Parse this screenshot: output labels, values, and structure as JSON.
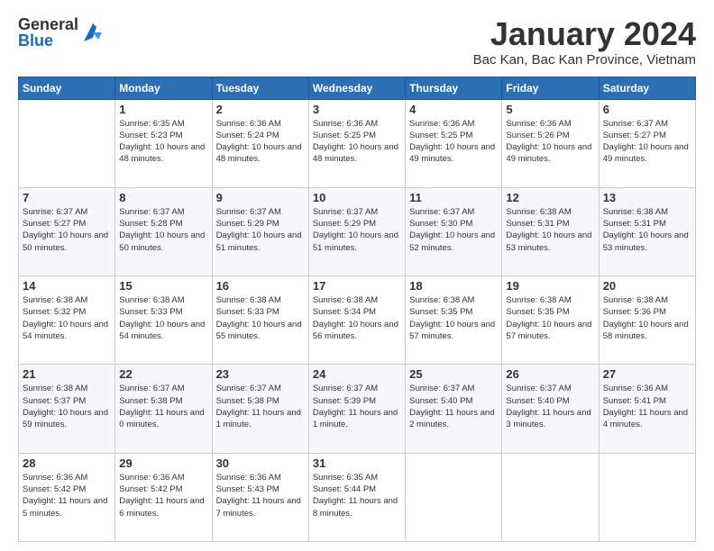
{
  "logo": {
    "general": "General",
    "blue": "Blue"
  },
  "header": {
    "month_title": "January 2024",
    "location": "Bac Kan, Bac Kan Province, Vietnam"
  },
  "days_of_week": [
    "Sunday",
    "Monday",
    "Tuesday",
    "Wednesday",
    "Thursday",
    "Friday",
    "Saturday"
  ],
  "weeks": [
    [
      {
        "day": "",
        "sunrise": "",
        "sunset": "",
        "daylight": ""
      },
      {
        "day": "1",
        "sunrise": "Sunrise: 6:35 AM",
        "sunset": "Sunset: 5:23 PM",
        "daylight": "Daylight: 10 hours and 48 minutes."
      },
      {
        "day": "2",
        "sunrise": "Sunrise: 6:36 AM",
        "sunset": "Sunset: 5:24 PM",
        "daylight": "Daylight: 10 hours and 48 minutes."
      },
      {
        "day": "3",
        "sunrise": "Sunrise: 6:36 AM",
        "sunset": "Sunset: 5:25 PM",
        "daylight": "Daylight: 10 hours and 48 minutes."
      },
      {
        "day": "4",
        "sunrise": "Sunrise: 6:36 AM",
        "sunset": "Sunset: 5:25 PM",
        "daylight": "Daylight: 10 hours and 49 minutes."
      },
      {
        "day": "5",
        "sunrise": "Sunrise: 6:36 AM",
        "sunset": "Sunset: 5:26 PM",
        "daylight": "Daylight: 10 hours and 49 minutes."
      },
      {
        "day": "6",
        "sunrise": "Sunrise: 6:37 AM",
        "sunset": "Sunset: 5:27 PM",
        "daylight": "Daylight: 10 hours and 49 minutes."
      }
    ],
    [
      {
        "day": "7",
        "sunrise": "Sunrise: 6:37 AM",
        "sunset": "Sunset: 5:27 PM",
        "daylight": "Daylight: 10 hours and 50 minutes."
      },
      {
        "day": "8",
        "sunrise": "Sunrise: 6:37 AM",
        "sunset": "Sunset: 5:28 PM",
        "daylight": "Daylight: 10 hours and 50 minutes."
      },
      {
        "day": "9",
        "sunrise": "Sunrise: 6:37 AM",
        "sunset": "Sunset: 5:29 PM",
        "daylight": "Daylight: 10 hours and 51 minutes."
      },
      {
        "day": "10",
        "sunrise": "Sunrise: 6:37 AM",
        "sunset": "Sunset: 5:29 PM",
        "daylight": "Daylight: 10 hours and 51 minutes."
      },
      {
        "day": "11",
        "sunrise": "Sunrise: 6:37 AM",
        "sunset": "Sunset: 5:30 PM",
        "daylight": "Daylight: 10 hours and 52 minutes."
      },
      {
        "day": "12",
        "sunrise": "Sunrise: 6:38 AM",
        "sunset": "Sunset: 5:31 PM",
        "daylight": "Daylight: 10 hours and 53 minutes."
      },
      {
        "day": "13",
        "sunrise": "Sunrise: 6:38 AM",
        "sunset": "Sunset: 5:31 PM",
        "daylight": "Daylight: 10 hours and 53 minutes."
      }
    ],
    [
      {
        "day": "14",
        "sunrise": "Sunrise: 6:38 AM",
        "sunset": "Sunset: 5:32 PM",
        "daylight": "Daylight: 10 hours and 54 minutes."
      },
      {
        "day": "15",
        "sunrise": "Sunrise: 6:38 AM",
        "sunset": "Sunset: 5:33 PM",
        "daylight": "Daylight: 10 hours and 54 minutes."
      },
      {
        "day": "16",
        "sunrise": "Sunrise: 6:38 AM",
        "sunset": "Sunset: 5:33 PM",
        "daylight": "Daylight: 10 hours and 55 minutes."
      },
      {
        "day": "17",
        "sunrise": "Sunrise: 6:38 AM",
        "sunset": "Sunset: 5:34 PM",
        "daylight": "Daylight: 10 hours and 56 minutes."
      },
      {
        "day": "18",
        "sunrise": "Sunrise: 6:38 AM",
        "sunset": "Sunset: 5:35 PM",
        "daylight": "Daylight: 10 hours and 57 minutes."
      },
      {
        "day": "19",
        "sunrise": "Sunrise: 6:38 AM",
        "sunset": "Sunset: 5:35 PM",
        "daylight": "Daylight: 10 hours and 57 minutes."
      },
      {
        "day": "20",
        "sunrise": "Sunrise: 6:38 AM",
        "sunset": "Sunset: 5:36 PM",
        "daylight": "Daylight: 10 hours and 58 minutes."
      }
    ],
    [
      {
        "day": "21",
        "sunrise": "Sunrise: 6:38 AM",
        "sunset": "Sunset: 5:37 PM",
        "daylight": "Daylight: 10 hours and 59 minutes."
      },
      {
        "day": "22",
        "sunrise": "Sunrise: 6:37 AM",
        "sunset": "Sunset: 5:38 PM",
        "daylight": "Daylight: 11 hours and 0 minutes."
      },
      {
        "day": "23",
        "sunrise": "Sunrise: 6:37 AM",
        "sunset": "Sunset: 5:38 PM",
        "daylight": "Daylight: 11 hours and 1 minute."
      },
      {
        "day": "24",
        "sunrise": "Sunrise: 6:37 AM",
        "sunset": "Sunset: 5:39 PM",
        "daylight": "Daylight: 11 hours and 1 minute."
      },
      {
        "day": "25",
        "sunrise": "Sunrise: 6:37 AM",
        "sunset": "Sunset: 5:40 PM",
        "daylight": "Daylight: 11 hours and 2 minutes."
      },
      {
        "day": "26",
        "sunrise": "Sunrise: 6:37 AM",
        "sunset": "Sunset: 5:40 PM",
        "daylight": "Daylight: 11 hours and 3 minutes."
      },
      {
        "day": "27",
        "sunrise": "Sunrise: 6:36 AM",
        "sunset": "Sunset: 5:41 PM",
        "daylight": "Daylight: 11 hours and 4 minutes."
      }
    ],
    [
      {
        "day": "28",
        "sunrise": "Sunrise: 6:36 AM",
        "sunset": "Sunset: 5:42 PM",
        "daylight": "Daylight: 11 hours and 5 minutes."
      },
      {
        "day": "29",
        "sunrise": "Sunrise: 6:36 AM",
        "sunset": "Sunset: 5:42 PM",
        "daylight": "Daylight: 11 hours and 6 minutes."
      },
      {
        "day": "30",
        "sunrise": "Sunrise: 6:36 AM",
        "sunset": "Sunset: 5:43 PM",
        "daylight": "Daylight: 11 hours and 7 minutes."
      },
      {
        "day": "31",
        "sunrise": "Sunrise: 6:35 AM",
        "sunset": "Sunset: 5:44 PM",
        "daylight": "Daylight: 11 hours and 8 minutes."
      },
      {
        "day": "",
        "sunrise": "",
        "sunset": "",
        "daylight": ""
      },
      {
        "day": "",
        "sunrise": "",
        "sunset": "",
        "daylight": ""
      },
      {
        "day": "",
        "sunrise": "",
        "sunset": "",
        "daylight": ""
      }
    ]
  ]
}
